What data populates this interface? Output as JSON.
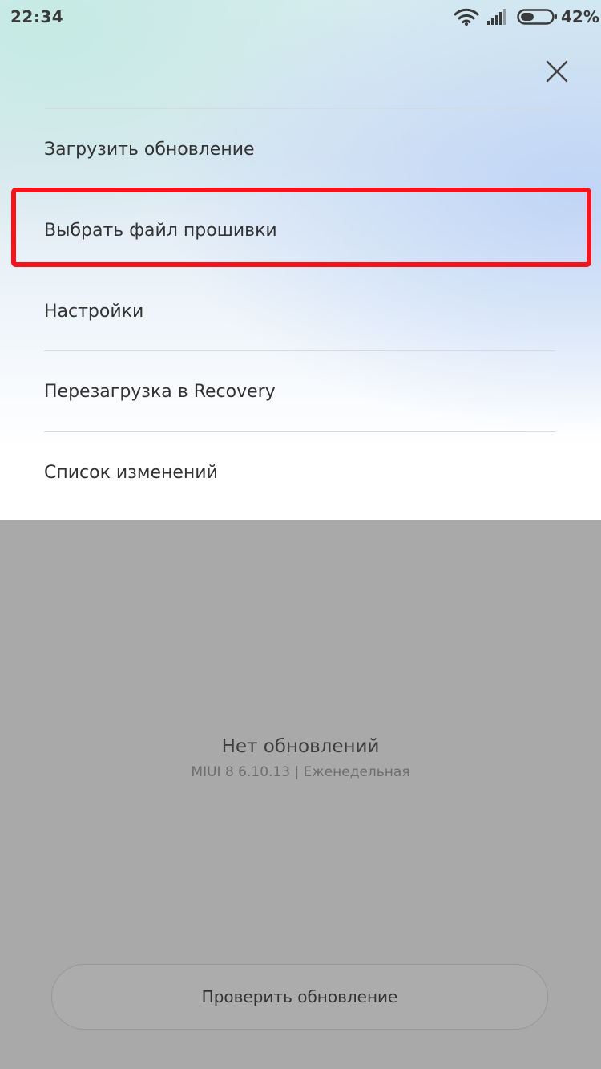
{
  "status_bar": {
    "time": "22:34",
    "battery_percent": "42%",
    "battery_level": 0.42,
    "icons": [
      "wifi-icon",
      "signal-icon",
      "battery-icon"
    ]
  },
  "menu": {
    "close_icon": "close-icon",
    "items": [
      {
        "label": "Загрузить обновление"
      },
      {
        "label": "Выбрать файл прошивки",
        "highlighted": true
      },
      {
        "label": "Настройки"
      },
      {
        "label": "Перезагрузка в Recovery"
      },
      {
        "label": "Список изменений"
      }
    ]
  },
  "update_status": {
    "title": "Нет обновлений",
    "version": "MIUI 8 6.10.13 | Еженедельная"
  },
  "check_button": {
    "label": "Проверить обновление"
  },
  "colors": {
    "highlight": "#f5141a",
    "overlay": "#a9a9a9"
  }
}
